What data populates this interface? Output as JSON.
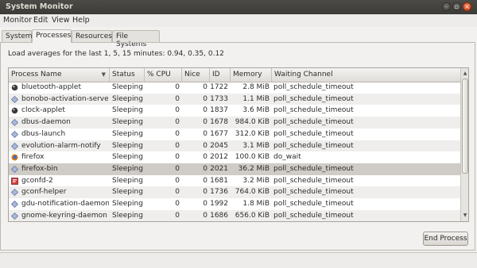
{
  "window": {
    "title": "System Monitor"
  },
  "menubar": {
    "items": [
      "Monitor",
      "Edit",
      "View",
      "Help"
    ]
  },
  "tabs": [
    {
      "label": "System",
      "active": false
    },
    {
      "label": "Processes",
      "active": true
    },
    {
      "label": "Resources",
      "active": false
    },
    {
      "label": "File Systems",
      "active": false
    }
  ],
  "processes": {
    "load_averages": "Load averages for the last 1, 5, 15 minutes: 0.94, 0.35, 0.12",
    "columns": [
      "Process Name",
      "Status",
      "% CPU",
      "Nice",
      "ID",
      "Memory",
      "Waiting Channel"
    ],
    "sorted_column": "Process Name",
    "rows": [
      {
        "name": "bluetooth-applet",
        "status": "Sleeping",
        "cpu": "0",
        "nice": "0",
        "id": "1722",
        "memory": "2.8 MiB",
        "channel": "poll_schedule_timeout",
        "icon": "app-icon"
      },
      {
        "name": "bonobo-activation-server",
        "status": "Sleeping",
        "cpu": "0",
        "nice": "0",
        "id": "1733",
        "memory": "1.1 MiB",
        "channel": "poll_schedule_timeout",
        "icon": "diamond-icon"
      },
      {
        "name": "clock-applet",
        "status": "Sleeping",
        "cpu": "0",
        "nice": "0",
        "id": "1837",
        "memory": "3.6 MiB",
        "channel": "poll_schedule_timeout",
        "icon": "app-icon"
      },
      {
        "name": "dbus-daemon",
        "status": "Sleeping",
        "cpu": "0",
        "nice": "0",
        "id": "1678",
        "memory": "984.0 KiB",
        "channel": "poll_schedule_timeout",
        "icon": "diamond-icon"
      },
      {
        "name": "dbus-launch",
        "status": "Sleeping",
        "cpu": "0",
        "nice": "0",
        "id": "1677",
        "memory": "312.0 KiB",
        "channel": "poll_schedule_timeout",
        "icon": "diamond-icon"
      },
      {
        "name": "evolution-alarm-notify",
        "status": "Sleeping",
        "cpu": "0",
        "nice": "0",
        "id": "2045",
        "memory": "3.1 MiB",
        "channel": "poll_schedule_timeout",
        "icon": "diamond-icon"
      },
      {
        "name": "firefox",
        "status": "Sleeping",
        "cpu": "0",
        "nice": "0",
        "id": "2012",
        "memory": "100.0 KiB",
        "channel": "do_wait",
        "icon": "firefox-icon"
      },
      {
        "name": "firefox-bin",
        "status": "Sleeping",
        "cpu": "0",
        "nice": "0",
        "id": "2021",
        "memory": "36.2 MiB",
        "channel": "poll_schedule_timeout",
        "icon": "diamond-icon",
        "selected": true
      },
      {
        "name": "gconfd-2",
        "status": "Sleeping",
        "cpu": "0",
        "nice": "0",
        "id": "1681",
        "memory": "3.2 MiB",
        "channel": "poll_schedule_timeout",
        "icon": "gconf-icon"
      },
      {
        "name": "gconf-helper",
        "status": "Sleeping",
        "cpu": "0",
        "nice": "0",
        "id": "1736",
        "memory": "764.0 KiB",
        "channel": "poll_schedule_timeout",
        "icon": "diamond-icon"
      },
      {
        "name": "gdu-notification-daemon",
        "status": "Sleeping",
        "cpu": "0",
        "nice": "0",
        "id": "1992",
        "memory": "1.8 MiB",
        "channel": "poll_schedule_timeout",
        "icon": "diamond-icon"
      },
      {
        "name": "gnome-keyring-daemon",
        "status": "Sleeping",
        "cpu": "0",
        "nice": "0",
        "id": "1686",
        "memory": "656.0 KiB",
        "channel": "poll_schedule_timeout",
        "icon": "diamond-icon"
      }
    ]
  },
  "actions": {
    "end_process": "End Process"
  },
  "colors": {
    "titlebar": "#3c3b37",
    "close_button": "#df5a2a",
    "selected_row": "#cfcbc6"
  }
}
